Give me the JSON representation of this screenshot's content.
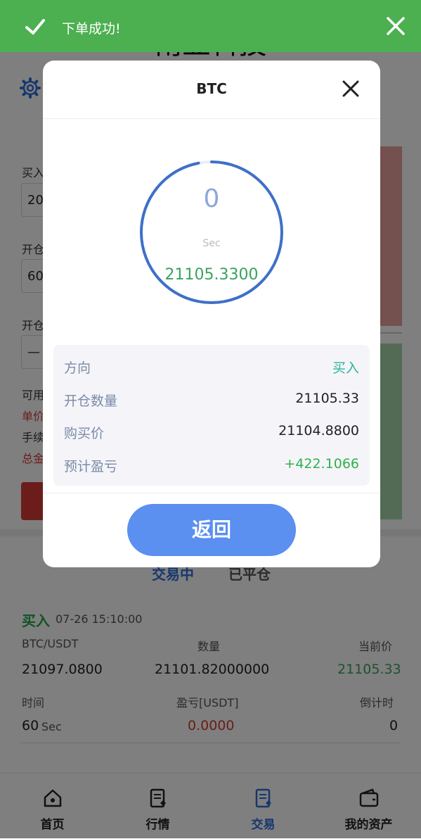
{
  "app": {
    "title": "南亚科技"
  },
  "form": {
    "buy_label": "买入",
    "buy_value": "20",
    "open_label": "开仓",
    "open_value": "60",
    "open2_label": "开仓",
    "stepper_value": "—",
    "available_label": "可用",
    "unit_price_label": "单价",
    "fee_label": "手续",
    "total_label": "总金"
  },
  "tabs": {
    "active": "交易中",
    "inactive": "已平仓"
  },
  "order": {
    "direction": "买入",
    "time": "07-26 15:10:00",
    "pair_label": "BTC/USDT",
    "qty_label": "数量",
    "cur_price_label": "当前价",
    "pair_value": "21097.0800",
    "qty_value": "21101.82000000",
    "cur_price_value": "21105.33",
    "time_label": "时间",
    "pnl_label": "盈亏[USDT]",
    "countdown_label": "倒计时",
    "time_value": "60",
    "time_unit": "Sec",
    "pnl_value": "0.0000",
    "countdown_value": "0"
  },
  "tabbar": [
    {
      "label": "首页",
      "icon": "home-icon"
    },
    {
      "label": "行情",
      "icon": "market-icon"
    },
    {
      "label": "交易",
      "icon": "trade-icon"
    },
    {
      "label": "我的资产",
      "icon": "wallet-icon"
    }
  ],
  "toast": {
    "text": "下单成功!"
  },
  "modal": {
    "title": "BTC",
    "ring_price": "21105.3300",
    "info": {
      "direction_label": "方向",
      "direction_value": "买入",
      "qty_label": "开仓数量",
      "qty_value": "21105.33",
      "buy_price_label": "购买价",
      "buy_price_value": "21104.8800",
      "pnl_label": "预计盈亏",
      "pnl_value": "+422.1066"
    },
    "back_label": "返回"
  },
  "colors": {
    "accent_blue": "#2f6fdc",
    "toast_green": "#4caf50",
    "buy_green": "#23a64a",
    "sell_red": "#d43a34",
    "back_button": "#5b8ff0"
  },
  "countdown_progress": 0.97
}
